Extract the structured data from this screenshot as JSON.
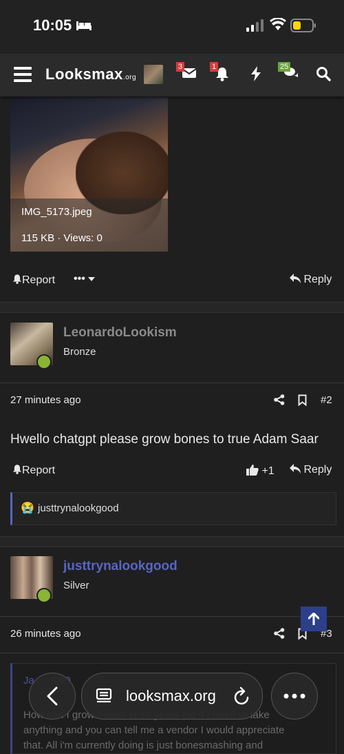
{
  "status_bar": {
    "time": "10:05"
  },
  "nav": {
    "logo_main": "Looksmax",
    "logo_suffix": ".org",
    "badges": {
      "conversations": "3",
      "alerts": "1",
      "whats_new": "25"
    }
  },
  "attachment": {
    "filename": "IMG_5173.jpeg",
    "meta": "115 KB · Views: 0"
  },
  "post1_actions": {
    "report": "Report",
    "more": "•••",
    "reply": "Reply"
  },
  "post2": {
    "username": "LeonardoLookism",
    "user_title": "Bronze",
    "time": "27 minutes ago",
    "post_number": "#2",
    "body": "Hwello chatgpt please grow bones to true Adam Saar",
    "report": "Report",
    "like_count": "+1",
    "reply": "Reply",
    "reaction_user": "justtrynalookgood",
    "reaction_emoji": "😭"
  },
  "post3": {
    "username": "justtrynalookgood",
    "user_title": "Silver",
    "time": "26 minutes ago",
    "post_number": "#3",
    "quote_author": "Ja      TN9",
    "quote_text_1": "How can I grow bones at 19 years old if I need to take",
    "quote_text_2": "anything and you can tell me a vendor I would appreciate",
    "quote_text_3": "that. All i'm currently doing is just bonesmashing and"
  },
  "browser": {
    "url": "looksmax.org"
  },
  "colors": {
    "accent_blue": "#5865c4",
    "online_green": "#8ab534",
    "badge_red": "#d63c3c",
    "badge_green": "#6aa63a"
  }
}
